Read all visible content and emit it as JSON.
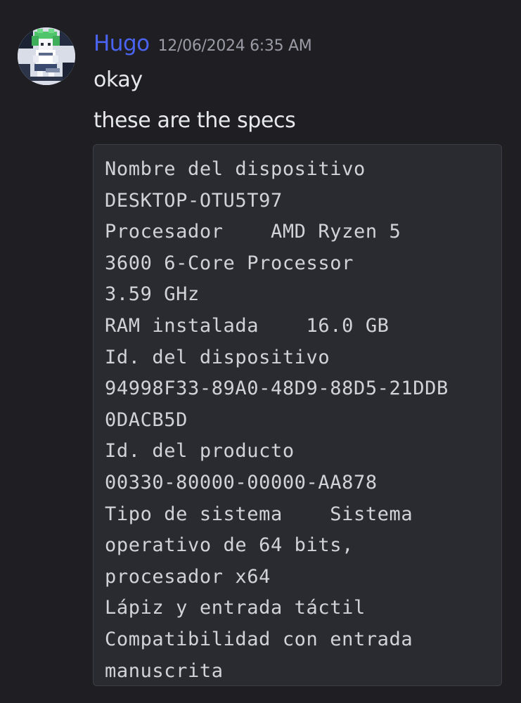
{
  "message": {
    "author": "Hugo",
    "timestamp": "12/06/2024 6:35 AM",
    "lines": [
      "okay",
      "these are the specs"
    ],
    "code_lines": [
      "Nombre del dispositivo",
      "DESKTOP-OTU5T97",
      "Procesador    AMD Ryzen 5",
      "3600 6-Core Processor",
      "3.59 GHz",
      "RAM instalada    16.0 GB",
      "Id. del dispositivo",
      "94998F33-89A0-48D9-88D5-21DDB",
      "0DACB5D",
      "Id. del producto",
      "00330-80000-00000-AA878",
      "Tipo de sistema    Sistema",
      "operativo de 64 bits,",
      "procesador x64",
      "Lápiz y entrada táctil",
      "Compatibilidad con entrada",
      "manuscrita"
    ]
  },
  "colors": {
    "background": "#1f1f23",
    "username": "#4a63f1",
    "timestamp": "#9a9ba4",
    "text": "#e7e8ec",
    "code_background": "#2a2b31",
    "code_text": "#d2d3d9"
  },
  "avatar": {
    "icon": "pixel-art-character-avatar"
  }
}
